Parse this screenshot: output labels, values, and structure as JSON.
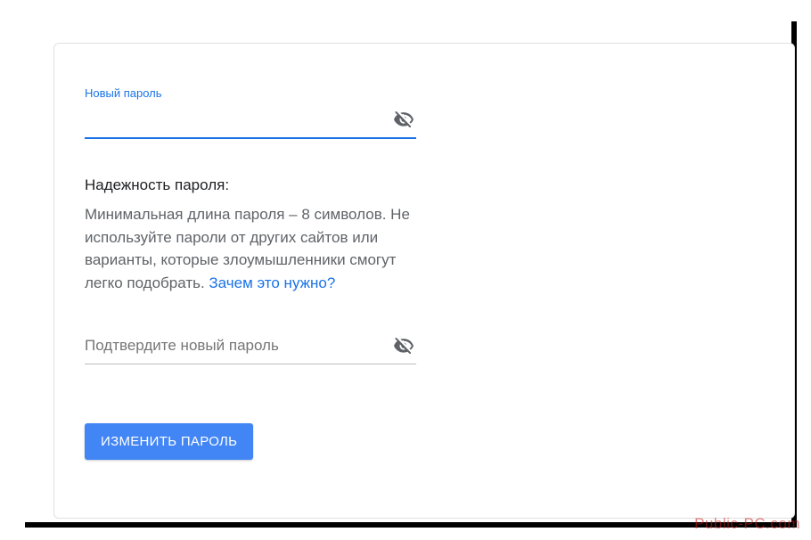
{
  "new_password": {
    "label": "Новый пароль",
    "value": ""
  },
  "strength": {
    "title": "Надежность пароля:",
    "text": "Минимальная длина пароля – 8 символов. Не используйте пароли от других сайтов или варианты, которые злоумышленники смогут легко подобрать. ",
    "link": "Зачем это нужно?"
  },
  "confirm_password": {
    "placeholder": "Подтвердите новый пароль",
    "value": ""
  },
  "submit_label": "ИЗМЕНИТЬ ПАРОЛЬ",
  "watermark": "Public-PC.com"
}
